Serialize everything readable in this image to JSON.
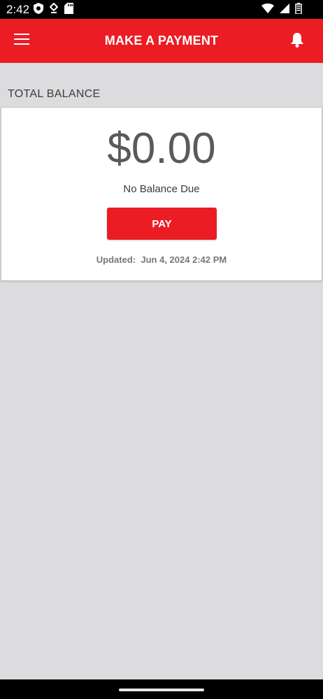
{
  "status_bar": {
    "time": "2:42",
    "left_icons": [
      "shield-icon",
      "location-pin-icon",
      "sd-card-icon"
    ],
    "right_icons": [
      "wifi-icon",
      "cell-signal-icon",
      "battery-icon"
    ]
  },
  "app_bar": {
    "title": "MAKE A PAYMENT",
    "menu_icon": "hamburger-menu-icon",
    "notification_icon": "bell-icon"
  },
  "section": {
    "label": "TOTAL BALANCE"
  },
  "balance": {
    "amount": "$0.00",
    "status": "No Balance Due",
    "pay_label": "PAY",
    "updated_prefix": "Updated:",
    "updated_value": "Jun 4, 2024 2:42 PM"
  },
  "colors": {
    "brand_red": "#ec1c24",
    "background": "#dcdbde"
  }
}
